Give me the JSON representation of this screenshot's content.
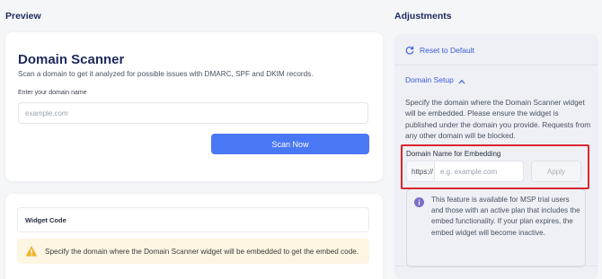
{
  "preview": {
    "heading": "Preview",
    "scanner": {
      "title": "Domain Scanner",
      "subtitle": "Scan a domain to get it analyzed for possible issues with DMARC, SPF and DKIM records.",
      "input_label": "Enter your domain name",
      "input_placeholder": "example.com",
      "scan_button": "Scan Now"
    },
    "widget": {
      "label": "Widget Code",
      "warning": "Specify the domain where the Domain Scanner widget will be embedded to get the embed code.",
      "warning_icon": "warning-triangle-icon"
    }
  },
  "adjustments": {
    "heading": "Adjustments",
    "reset_label": "Reset to Default",
    "reset_icon": "refresh-icon",
    "section_title": "Domain Setup",
    "section_icon": "chevron-up-icon",
    "description": "Specify the domain where the Domain Scanner widget will be embedded. Please ensure the widget is published under the domain you provide. Requests from any other domain will be blocked.",
    "embed_label": "Domain Name for Embedding",
    "protocol": "https://",
    "domain_placeholder": "e.g. example.com",
    "apply_button": "Apply",
    "info_icon": "info-icon",
    "info_text": "This feature is available for MSP trial users and those with an active plan that includes the embed functionality. If your plan expires, the embed widget will become inactive."
  },
  "colors": {
    "accent": "#4a77f3",
    "link": "#3b5bd6",
    "heading": "#1d2a5c",
    "highlight": "#d9262e",
    "warning_bg": "#fdf6e3",
    "info_icon": "#7b6fc9"
  }
}
